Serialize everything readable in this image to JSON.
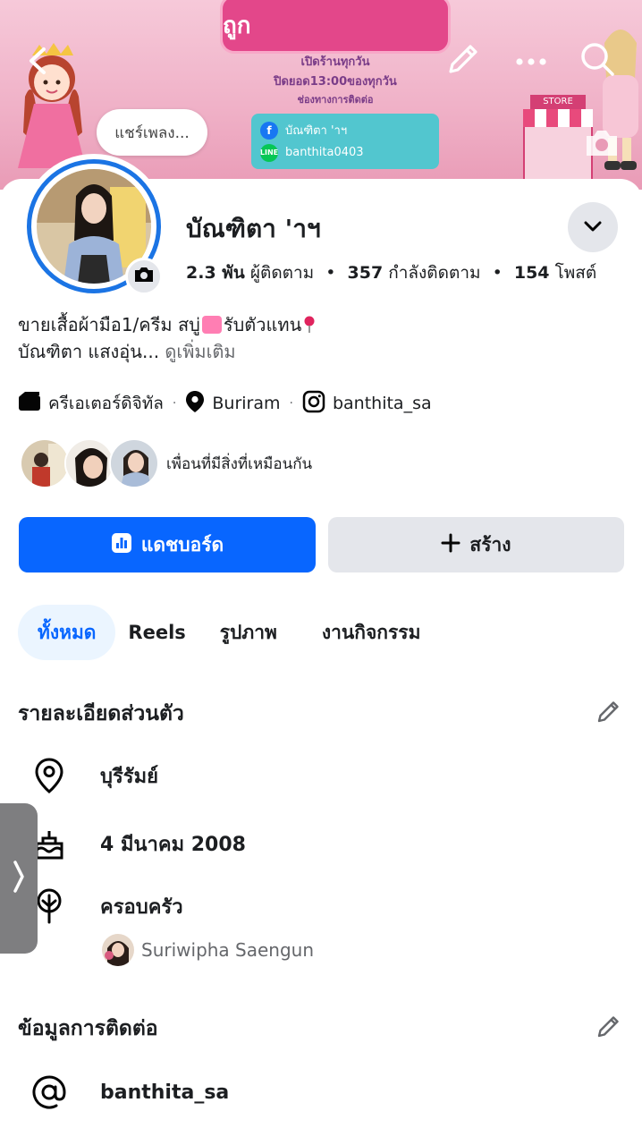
{
  "cover": {
    "banner_title": "สินค้าดี น่ารัก ราคาถูก",
    "line1": "เปิดร้านทุกวัน",
    "line2": "ปิดยอด13:00ของทุกวัน",
    "line3": "ช่องทางการติดต่อ",
    "contact_facebook": "บัณฑิตา 'าฯ",
    "contact_line": "banthita0403",
    "store_sign": "STORE"
  },
  "song_bubble": "แชร์เพลง...",
  "profile": {
    "name": "บัณฑิตา 'าฯ",
    "followers": "2.3 พัน",
    "followers_label": "ผู้ติดตาม",
    "following": "357",
    "following_label": "กำลังติดตาม",
    "posts": "154",
    "posts_label": "โพสต์",
    "stat_sep": "•",
    "bio_line1_a": "ขายเสื้อผ้ามือ1/ครีม สบู่",
    "bio_line1_b": "รับตัวแทน",
    "bio_line2": "บัณฑิตา แสงอุ่น...",
    "bio_more": "ดูเพิ่มเติม"
  },
  "meta": {
    "category": "ครีเอเตอร์ดิจิทัล",
    "location": "Buriram",
    "instagram": "banthita_sa",
    "dot": "·"
  },
  "mutual_label": "เพื่อนที่มีสิ่งที่เหมือนกัน",
  "buttons": {
    "dashboard": "แดชบอร์ด",
    "create": "สร้าง"
  },
  "tabs": [
    "ทั้งหมด",
    "Reels",
    "รูปภาพ",
    "งานกิจกรรม"
  ],
  "personal": {
    "title": "รายละเอียดส่วนตัว",
    "hometown": "บุรีรัมย์",
    "birthday": "4 มีนาคม  2008",
    "family_label": "ครอบครัว",
    "family_member": "Suriwipha Saengun"
  },
  "contact": {
    "title": "ข้อมูลการติดต่อ",
    "instagram": "banthita_sa"
  },
  "colors": {
    "accent": "#0866ff",
    "cover_pink": "#f0b2c8",
    "button_gray": "#e4e6eb"
  },
  "icons": {
    "back": "chevron-left-icon",
    "edit_cover": "pencil-icon",
    "more": "more-horizontal-icon",
    "search": "search-icon",
    "camera": "camera-icon",
    "chevron": "chevron-down-icon",
    "side_handle": "chevron-right-icon"
  }
}
